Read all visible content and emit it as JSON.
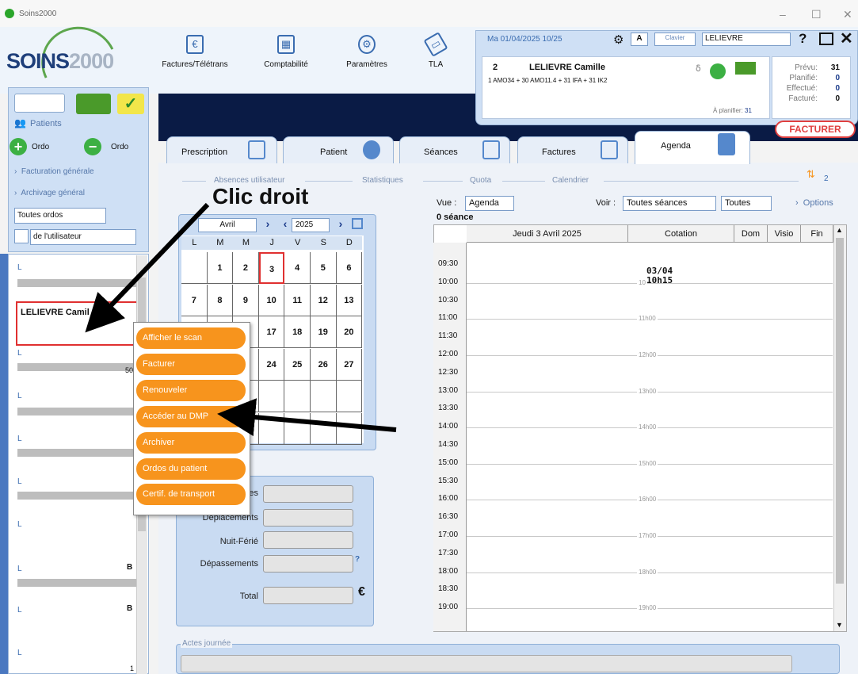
{
  "window": {
    "title": "Soins2000",
    "controls": [
      "–",
      "☐",
      "✕"
    ]
  },
  "logo": {
    "text_main": "SOINS",
    "text_num": "2000"
  },
  "toolbar": {
    "items": [
      {
        "label": "Factures/Télétrans",
        "icon": "invoice-icon"
      },
      {
        "label": "Comptabilité",
        "icon": "calculator-icon"
      },
      {
        "label": "Paramètres",
        "icon": "gears-icon"
      },
      {
        "label": "TLA",
        "icon": "tla-device-icon"
      }
    ]
  },
  "patient_panel": {
    "date": "Ma 01/04/2025  10/25",
    "mode_letter": "A",
    "keyboard_label": "Clavier",
    "patient_select": "LELIEVRE",
    "patient_number": "2",
    "patient_name": "LELIEVRE Camille",
    "acts": "1 AMO34 + 30 AMO11.4 + 31 IFA + 31 IK2",
    "a_planifier_label": "À planifier:",
    "a_planifier_value": "31",
    "counters": [
      {
        "label": "Prévu:",
        "value": "31"
      },
      {
        "label": "Planifié:",
        "value": "0"
      },
      {
        "label": "Effectué:",
        "value": "0"
      },
      {
        "label": "Facturé:",
        "value": "0"
      }
    ],
    "facturer_label": "FACTURER"
  },
  "sidebar": {
    "patients_label": "Patients",
    "ordo_add": "Ordo",
    "ordo_remove": "Ordo",
    "links": [
      "Facturation générale",
      "Archivage général"
    ],
    "filter_select": "Toutes ordos",
    "user_filter": "de l'utilisateur",
    "list": [
      {
        "label": "L"
      },
      {
        "label": "LELIEVRE Camil"
      },
      {
        "label": "L",
        "extra": "50"
      },
      {
        "label": "L"
      },
      {
        "label": "L"
      },
      {
        "label": "L"
      },
      {
        "label": "L"
      },
      {
        "label": "L",
        "extra": "B"
      },
      {
        "label": "L",
        "extra": "B"
      },
      {
        "label": "L"
      }
    ],
    "scroll_value": "1"
  },
  "tabs": [
    {
      "label": "Prescription"
    },
    {
      "label": "Patient"
    },
    {
      "label": "Séances"
    },
    {
      "label": "Factures"
    },
    {
      "label": "Agenda"
    }
  ],
  "subnav": {
    "items": [
      "Absences utilisateur",
      "Statistiques",
      "Quota",
      "Calendrier"
    ],
    "count": "2"
  },
  "calendar": {
    "month": "Avril",
    "year": "2025",
    "weekdays": [
      "L",
      "M",
      "M",
      "J",
      "V",
      "S",
      "D"
    ],
    "weeks": [
      [
        "",
        "1",
        "2",
        "3",
        "4",
        "5",
        "6"
      ],
      [
        "7",
        "8",
        "9",
        "10",
        "11",
        "12",
        "13"
      ],
      [
        "",
        "",
        "",
        "17",
        "18",
        "19",
        "20"
      ],
      [
        "",
        "",
        "",
        "24",
        "25",
        "26",
        "27"
      ],
      [
        "",
        "",
        "",
        "",
        "",
        "",
        ""
      ],
      [
        "",
        "",
        "",
        "",
        "",
        "",
        ""
      ]
    ],
    "today": "3"
  },
  "totals": {
    "rows": [
      {
        "label": "es"
      },
      {
        "label": "Déplacements"
      },
      {
        "label": "Nuit-Férié"
      },
      {
        "label": "Dépassements"
      },
      {
        "label": "Total"
      }
    ],
    "help": "?",
    "currency": "€"
  },
  "actes_journee": {
    "label": "Actes journée"
  },
  "agenda": {
    "vue_label": "Vue :",
    "vue_value": "Agenda",
    "voir_label": "Voir :",
    "voir_value": "Toutes séances",
    "voir_value2": "Toutes",
    "options_label": "Options",
    "seance_count": "0 séance",
    "columns": [
      "Jeudi 3 Avril 2025",
      "Cotation",
      "Dom",
      "Visio",
      "Fin"
    ],
    "times": [
      "09:30",
      "10:00",
      "10:30",
      "11:00",
      "11:30",
      "12:00",
      "12:30",
      "13:00",
      "13:30",
      "14:00",
      "14:30",
      "15:00",
      "15:30",
      "16:00",
      "16:30",
      "17:00",
      "17:30",
      "18:00",
      "18:30",
      "19:00"
    ],
    "hour_tags": [
      "10",
      "11h00",
      "12h00",
      "13h00",
      "14h00",
      "15h00",
      "16h00",
      "17h00",
      "18h00",
      "19h00"
    ],
    "event_date": "03/04",
    "event_time": "10h15"
  },
  "context_menu": {
    "items": [
      "Afficher le scan",
      "Facturer",
      "Renouveler",
      "Accéder au DMP",
      "Archiver",
      "Ordos du patient",
      "Certif. de transport"
    ]
  },
  "annotation": {
    "text": "Clic droit"
  },
  "colors": {
    "accent_orange": "#f7941d",
    "dark_band": "#0a1b45",
    "panel_blue": "#cfe0f5",
    "alert_red": "#e03030"
  }
}
